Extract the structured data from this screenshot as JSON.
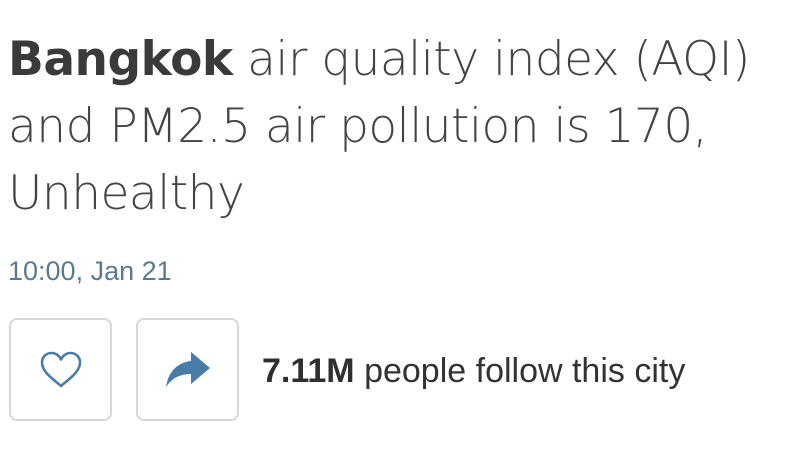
{
  "header": {
    "city": "Bangkok",
    "headline_rest": " air quality index (AQI) and PM2.5 air pollution is 170, Unhealthy"
  },
  "update": {
    "timestamp": "10:00, Jan 21"
  },
  "actions": {
    "like_icon": "heart-outline-icon",
    "share_icon": "share-arrow-icon",
    "icon_color": "#4a7ca8"
  },
  "followers": {
    "count": "7.11M",
    "text": " people follow this city"
  }
}
